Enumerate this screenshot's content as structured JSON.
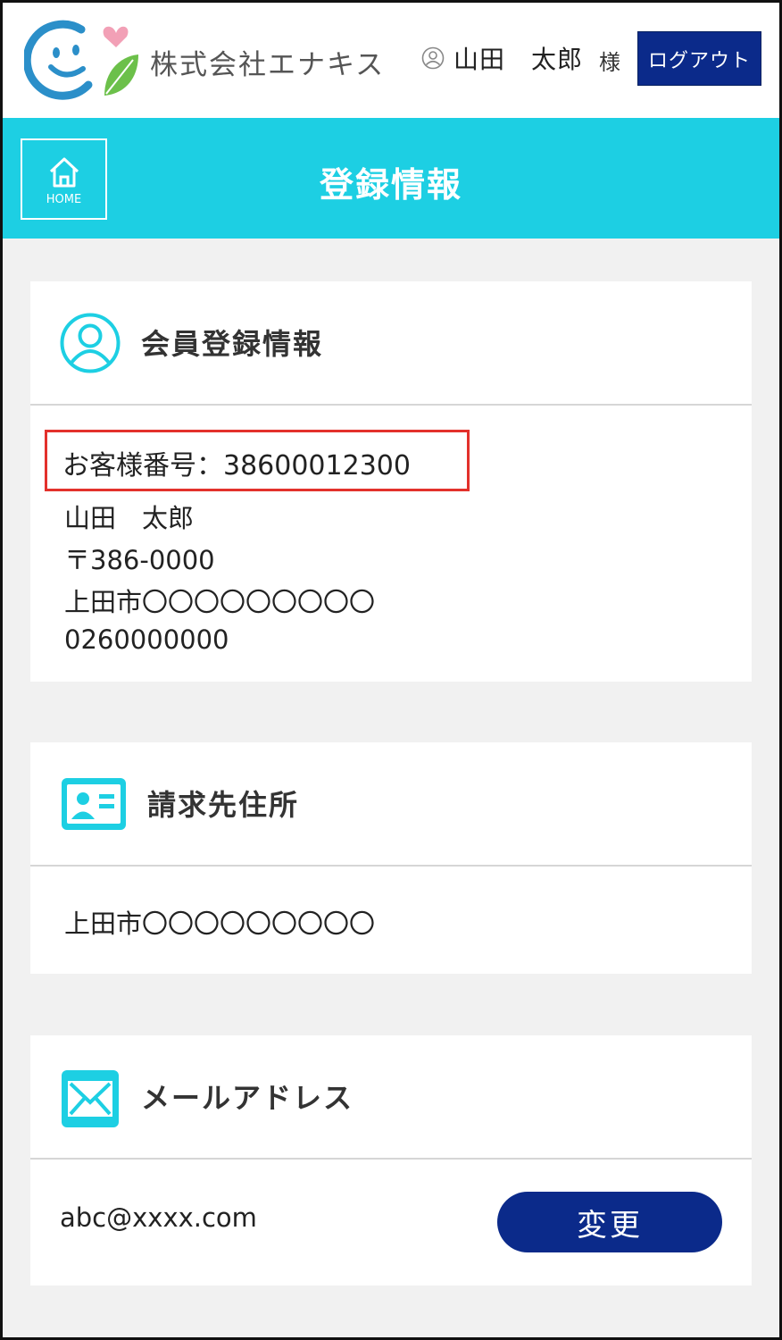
{
  "header": {
    "company_name": "株式会社エナキス",
    "user_name": "山田　太郎",
    "honorific": "様",
    "logout_label": "ログアウト"
  },
  "titlebar": {
    "home_label": "HOME",
    "title": "登録情報"
  },
  "member_info": {
    "title": "会員登録情報",
    "customer_number_line": "お客様番号：38600012300",
    "name": "山田　太郎",
    "postal_code": "〒386-0000",
    "address": "上田市〇〇〇〇〇〇〇〇〇",
    "phone": "0260000000"
  },
  "billing_address": {
    "title": "請求先住所",
    "address": "上田市〇〇〇〇〇〇〇〇〇"
  },
  "email": {
    "title": "メールアドレス",
    "address": "abc@xxxx.com",
    "change_label": "変更"
  },
  "colors": {
    "accent_cyan": "#1dcfe3",
    "navy": "#0b2a8a",
    "highlight_red": "#e3312c",
    "background": "#f1f1f1"
  }
}
